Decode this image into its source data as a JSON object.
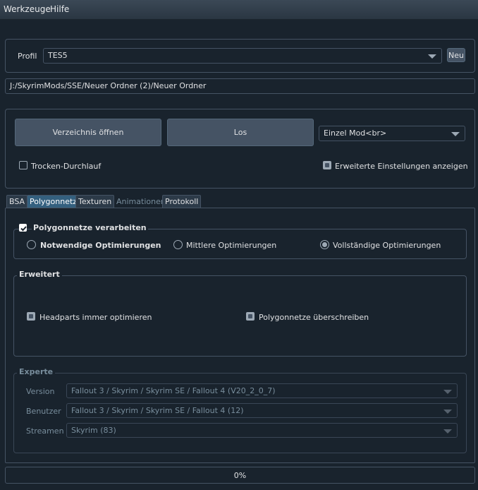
{
  "menu": {
    "items": [
      "Werkzeuge",
      "Hilfe"
    ]
  },
  "profile": {
    "label": "Profil",
    "value": "TES5",
    "new_button": "Neu"
  },
  "path": {
    "value": "J:/SkyrimMods/SSE/Neuer Ordner (2)/Neuer Ordner"
  },
  "actions": {
    "open_dir": "Verzeichnis öffnen",
    "run": "Los",
    "mode": "Einzel Mod<br>",
    "dry_run": "Trocken-Durchlauf",
    "dry_run_checked": false,
    "advanced_settings": "Erweiterte Einstellungen anzeigen",
    "advanced_settings_checked": true
  },
  "tabs": [
    "BSA",
    "Polygonnetz",
    "Texturen",
    "Animationen",
    "Protokoll"
  ],
  "active_tab": "Polygonnetz",
  "mesh": {
    "process_label": "Polygonnetze verarbeiten",
    "process_checked": true,
    "options": [
      "Notwendige Optimierungen",
      "Mittlere Optimierungen",
      "Vollständige Optimierungen"
    ],
    "selected_option": "Vollständige Optimierungen"
  },
  "advanced": {
    "title": "Erweitert",
    "headparts": "Headparts immer optimieren",
    "headparts_checked": true,
    "overwrite": "Polygonnetze überschreiben",
    "overwrite_checked": true
  },
  "expert": {
    "title": "Experte",
    "version_label": "Version",
    "version_value": "Fallout 3 / Skyrim / Skyrim SE / Fallout 4 (V20_2_0_7)",
    "user_label": "Benutzer",
    "user_value": "Fallout 3 / Skyrim / Skyrim SE / Fallout 4 (12)",
    "stream_label": "Streamen",
    "stream_value": "Skyrim (83)"
  },
  "progress": {
    "text": "0%",
    "value": 0
  },
  "colors": {
    "background": "#19232d",
    "border": "#455364",
    "button": "#455364",
    "active_tab": "#34607f"
  }
}
